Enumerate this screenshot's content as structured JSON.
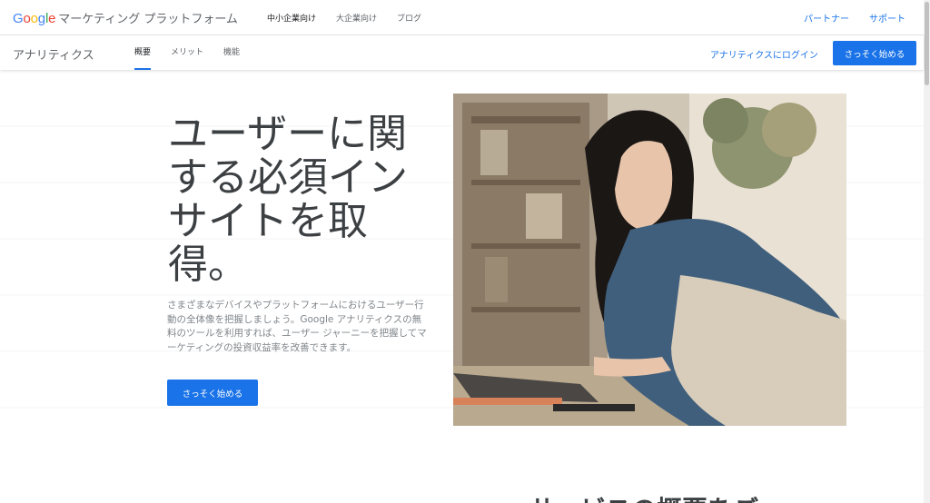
{
  "header": {
    "logo_letters": [
      "G",
      "o",
      "o",
      "g",
      "l",
      "e"
    ],
    "logo_colors": [
      "#4285F4",
      "#EA4335",
      "#FBBC05",
      "#4285F4",
      "#34A853",
      "#EA4335"
    ],
    "title": "マーケティング プラットフォーム",
    "nav": [
      {
        "label": "中小企業向け",
        "active": true
      },
      {
        "label": "大企業向け",
        "active": false
      },
      {
        "label": "ブログ",
        "active": false
      }
    ],
    "links": [
      "パートナー",
      "サポート"
    ]
  },
  "subnav": {
    "product": "アナリティクス",
    "tabs": [
      {
        "label": "概要",
        "active": true
      },
      {
        "label": "メリット",
        "active": false
      },
      {
        "label": "機能",
        "active": false
      }
    ],
    "login_label": "アナリティクスにログイン",
    "cta_label": "さっそく始める"
  },
  "hero": {
    "headline": "ユーザーに関する必須インサイトを取得。",
    "description": "さまざまなデバイスやプラットフォームにおけるユーザー行動の全体像を把握しましょう。Google アナリティクスの無料のツールを利用すれば、ユーザー ジャーニーを把握してマーケティングの投資収益率を改善できます。",
    "cta_label": "さっそく始める"
  },
  "next_section": {
    "heading": "サービスの概要をご"
  },
  "colors": {
    "accent": "#1a73e8",
    "text_dark": "#3c4043",
    "text_muted": "#80868b"
  }
}
